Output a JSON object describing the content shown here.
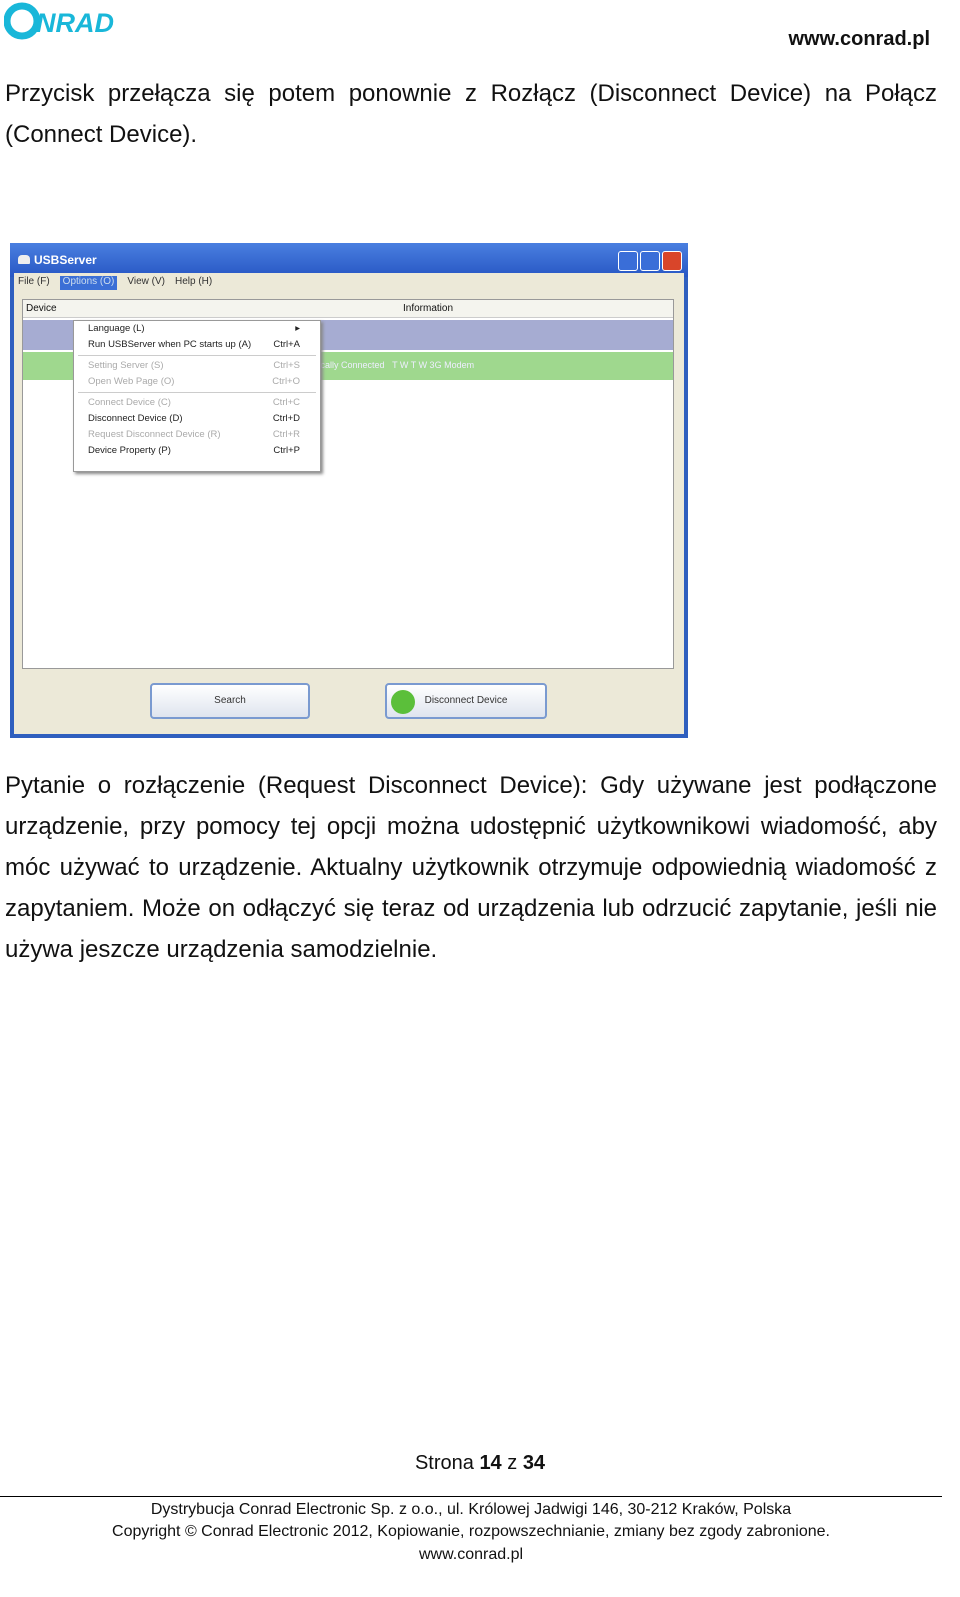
{
  "header": {
    "logo": "CONRAD",
    "url": "www.conrad.pl"
  },
  "intro": "Przycisk przełącza się potem ponownie z Rozłącz (Disconnect Device) na Połącz (Connect Device).",
  "screenshot": {
    "title": "USBServer",
    "menubar": [
      "File (F)",
      "Options (O)",
      "View (V)",
      "Help (H)"
    ],
    "columns": {
      "device": "Device",
      "information": "Information"
    },
    "row_status": "...cally Connected",
    "row_info": "T W T W 3G Modem",
    "menu": [
      {
        "label": "Language (L)",
        "shortcut": "▸",
        "enabled": true
      },
      {
        "label": "Run USBServer when PC starts up (A)",
        "shortcut": "Ctrl+A",
        "enabled": true
      },
      {
        "label": "Setting Server (S)",
        "shortcut": "Ctrl+S",
        "enabled": false
      },
      {
        "label": "Open Web Page (O)",
        "shortcut": "Ctrl+O",
        "enabled": false
      },
      {
        "label": "Connect Device (C)",
        "shortcut": "Ctrl+C",
        "enabled": false
      },
      {
        "label": "Disconnect Device (D)",
        "shortcut": "Ctrl+D",
        "enabled": true
      },
      {
        "label": "Request Disconnect Device (R)",
        "shortcut": "Ctrl+R",
        "enabled": false
      },
      {
        "label": "Device Property (P)",
        "shortcut": "Ctrl+P",
        "enabled": true
      }
    ],
    "search_button": "Search",
    "disconnect_button": "Disconnect Device"
  },
  "body": "Pytanie o rozłączenie (Request Disconnect Device): Gdy używane jest podłączone urządzenie, przy pomocy tej opcji można udostępnić użytkownikowi wiadomość, aby móc używać to urządzenie. Aktualny użytkownik otrzymuje odpowiednią wiadomość z zapytaniem. Może on odłączyć się teraz od urządzenia lub odrzucić zapytanie, jeśli nie używa jeszcze urządzenia samodzielnie.",
  "pager": {
    "prefix": "Strona",
    "page": "14",
    "sep": "z",
    "total": "34"
  },
  "footer": {
    "line1": "Dystrybucja Conrad Electronic Sp. z o.o., ul. Królowej Jadwigi 146, 30-212 Kraków, Polska",
    "line2": "Copyright © Conrad Electronic 2012, Kopiowanie, rozpowszechnianie, zmiany bez zgody zabronione.",
    "line3": "www.conrad.pl"
  }
}
